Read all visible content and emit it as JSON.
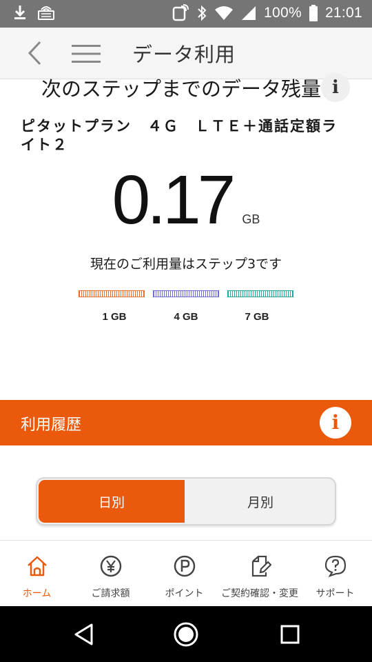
{
  "status_bar": {
    "battery": "100%",
    "time": "21:01"
  },
  "header": {
    "title": "データ利用"
  },
  "data_remaining": {
    "heading": "次のステップまでのデータ残量",
    "plan_name": "ピタットプラン　４Ｇ　ＬＴＥ＋通話定額ライト２",
    "value": "0.17",
    "unit": "GB",
    "current_step_text": "現在のご利用量はステップ3です",
    "steps": [
      {
        "label": "1 GB",
        "color": "#ef6c2a"
      },
      {
        "label": "4 GB",
        "color": "#6b6bd4"
      },
      {
        "label": "7 GB",
        "color": "#1fa8a0"
      }
    ]
  },
  "history": {
    "title": "利用履歴",
    "tabs": [
      "日別",
      "月別"
    ],
    "selected_tab": "日別"
  },
  "bottom_nav": {
    "items": [
      {
        "label": "ホーム",
        "icon": "home-icon",
        "active": true
      },
      {
        "label": "ご請求額",
        "icon": "yen-icon",
        "active": false
      },
      {
        "label": "ポイント",
        "icon": "point-icon",
        "active": false
      },
      {
        "label": "ご契約確認・変更",
        "icon": "contract-edit-icon",
        "active": false
      },
      {
        "label": "サポート",
        "icon": "help-icon",
        "active": false
      }
    ]
  },
  "colors": {
    "accent": "#eb5a0c",
    "status_bar": "#757575"
  }
}
